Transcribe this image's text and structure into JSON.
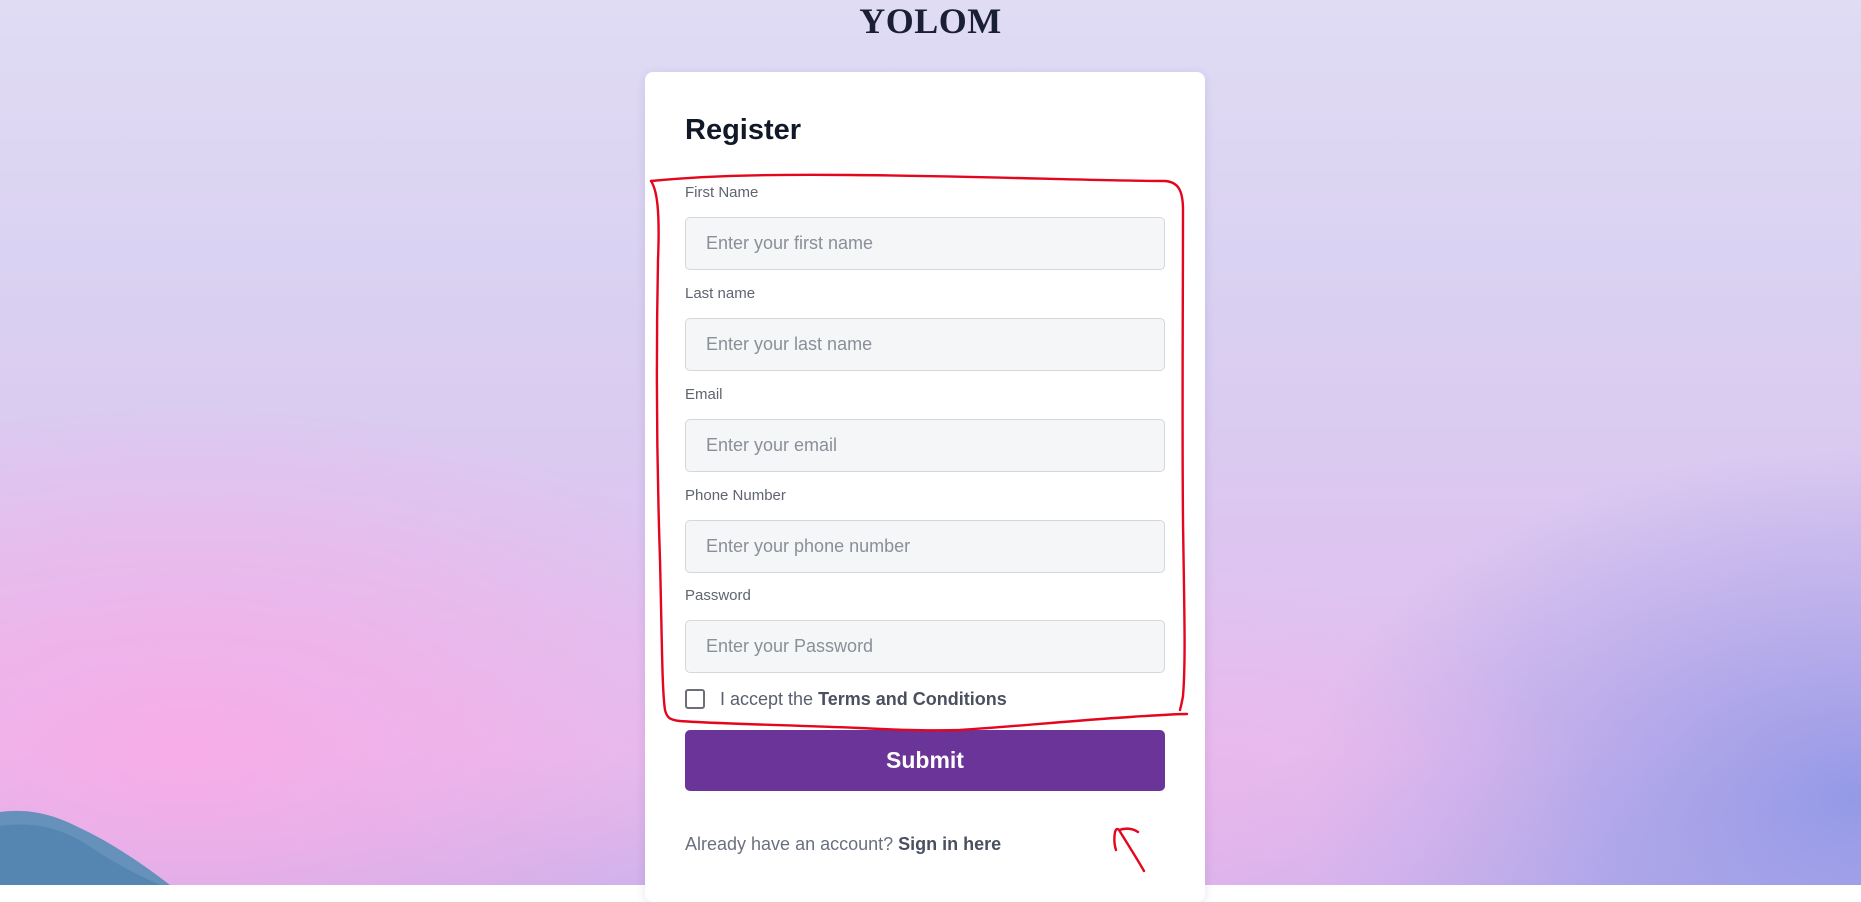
{
  "brand": "YOLOM",
  "form": {
    "title": "Register",
    "fields": [
      {
        "label": "First Name",
        "placeholder": "Enter your first name"
      },
      {
        "label": "Last name",
        "placeholder": "Enter your last name"
      },
      {
        "label": "Email",
        "placeholder": "Enter your email"
      },
      {
        "label": "Phone Number",
        "placeholder": "Enter your phone number"
      },
      {
        "label": "Password",
        "placeholder": "Enter your Password"
      }
    ],
    "terms": {
      "prefix": "I accept the ",
      "link": "Terms and Conditions"
    },
    "submit_label": "Submit",
    "signin": {
      "prefix": "Already have an account? ",
      "link": "Sign in here"
    }
  },
  "colors": {
    "accent": "#6a3499",
    "annotation": "#e3061d"
  }
}
